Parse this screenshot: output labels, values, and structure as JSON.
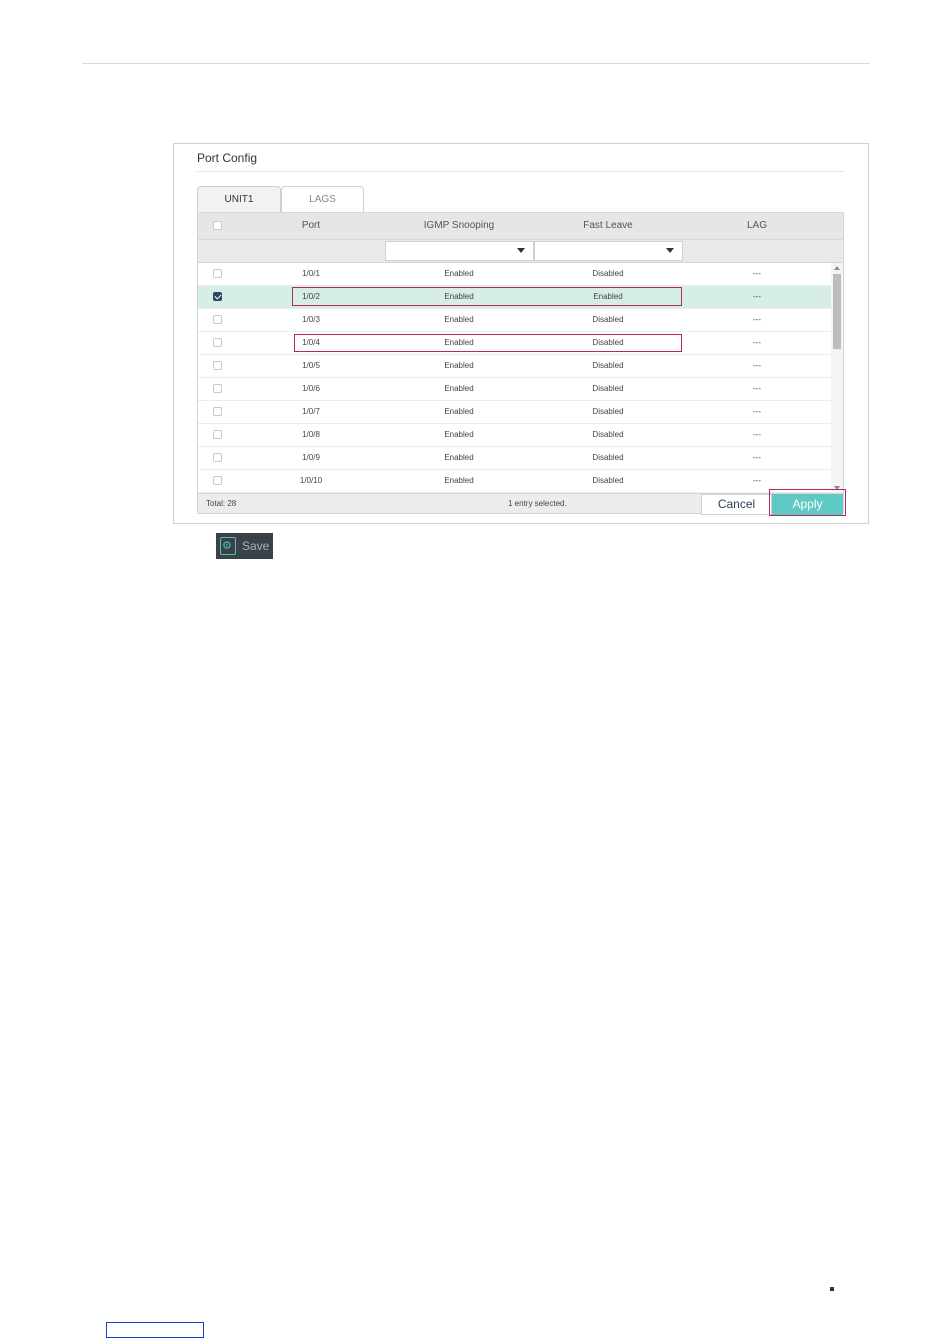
{
  "panel": {
    "title": "Port Config"
  },
  "tabs": [
    {
      "label": "UNIT1",
      "active": true
    },
    {
      "label": "LAGS",
      "active": false
    }
  ],
  "table": {
    "columns": [
      "Port",
      "IGMP Snooping",
      "Fast Leave",
      "LAG"
    ],
    "rows": [
      {
        "port": "1/0/1",
        "igmp": "Enabled",
        "fast_leave": "Disabled",
        "lag": "---",
        "selected": false
      },
      {
        "port": "1/0/2",
        "igmp": "Enabled",
        "fast_leave": "Enabled",
        "lag": "---",
        "selected": true
      },
      {
        "port": "1/0/3",
        "igmp": "Enabled",
        "fast_leave": "Disabled",
        "lag": "---",
        "selected": false
      },
      {
        "port": "1/0/4",
        "igmp": "Enabled",
        "fast_leave": "Disabled",
        "lag": "---",
        "selected": false
      },
      {
        "port": "1/0/5",
        "igmp": "Enabled",
        "fast_leave": "Disabled",
        "lag": "---",
        "selected": false
      },
      {
        "port": "1/0/6",
        "igmp": "Enabled",
        "fast_leave": "Disabled",
        "lag": "---",
        "selected": false
      },
      {
        "port": "1/0/7",
        "igmp": "Enabled",
        "fast_leave": "Disabled",
        "lag": "---",
        "selected": false
      },
      {
        "port": "1/0/8",
        "igmp": "Enabled",
        "fast_leave": "Disabled",
        "lag": "---",
        "selected": false
      },
      {
        "port": "1/0/9",
        "igmp": "Enabled",
        "fast_leave": "Disabled",
        "lag": "---",
        "selected": false
      },
      {
        "port": "1/0/10",
        "igmp": "Enabled",
        "fast_leave": "Disabled",
        "lag": "---",
        "selected": false
      }
    ],
    "footer": {
      "total": "Total: 28",
      "selection": "1 entry selected."
    }
  },
  "buttons": {
    "cancel": "Cancel",
    "apply": "Apply",
    "save": "Save"
  },
  "colors": {
    "accent": "#5fc9c5",
    "highlight": "#b22a5c",
    "selected_row": "#d6ede8"
  }
}
